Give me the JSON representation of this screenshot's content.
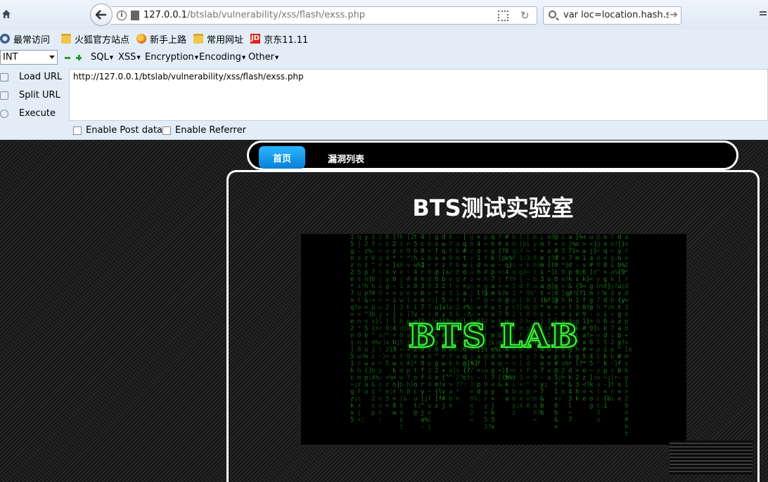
{
  "browser": {
    "url_host": "127.0.0.1",
    "url_path": "/btslab/vulnerability/xss/flash/exss.php",
    "search_text": "var loc=location.hash.slice"
  },
  "bookmarks": [
    {
      "label": "最常访问",
      "icon": "gear-icon"
    },
    {
      "label": "火狐官方站点",
      "icon": "folder-icon"
    },
    {
      "label": "新手上路",
      "icon": "firefox-icon"
    },
    {
      "label": "常用网址",
      "icon": "folder-icon"
    },
    {
      "label": "京东11.11",
      "icon": "jd-icon"
    }
  ],
  "hackbar": {
    "type_select": "INT",
    "menus": [
      "SQL",
      "XSS",
      "Encryption",
      "Encoding",
      "Other"
    ],
    "load_url": "Load URL",
    "split_url": "Split URL",
    "execute": "Execute",
    "url_value": "http://127.0.0.1/btslab/vulnerability/xss/flash/exss.php",
    "enable_post": "Enable Post data",
    "enable_referrer": "Enable Referrer"
  },
  "site": {
    "nav_home": "首页",
    "nav_vulns": "漏洞列表",
    "title": "BTS测试实验室",
    "banner_logo": "BTS LAB"
  },
  "colors": {
    "nav_home_active": "#0a8fe6",
    "banner_green": "#3cff3c"
  }
}
